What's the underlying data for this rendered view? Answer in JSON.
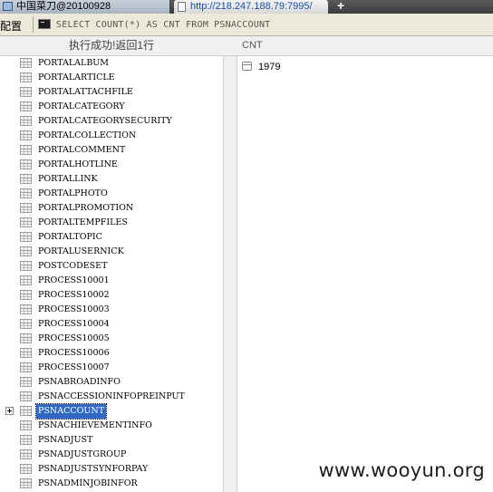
{
  "tabs": [
    {
      "label": "中国菜刀@20100928"
    },
    {
      "label": "http://218.247.188.79:7995/"
    }
  ],
  "new_tab_symbol": "+",
  "toolbar": {
    "config_label": "配置",
    "sql_query": "SELECT COUNT(*) AS CNT FROM PSNACCOUNT"
  },
  "status": {
    "message": "执行成功!返回1行"
  },
  "results": {
    "column_header": "CNT",
    "rows": [
      {
        "value": "1979"
      }
    ]
  },
  "tree": {
    "selected_table": "PSNACCOUNT",
    "tables": [
      "PORTALALBUM",
      "PORTALARTICLE",
      "PORTALATTACHFILE",
      "PORTALCATEGORY",
      "PORTALCATEGORYSECURITY",
      "PORTALCOLLECTION",
      "PORTALCOMMENT",
      "PORTALHOTLINE",
      "PORTALLINK",
      "PORTALPHOTO",
      "PORTALPROMOTION",
      "PORTALTEMPFILES",
      "PORTALTOPIC",
      "PORTALUSERNICK",
      "POSTCODESET",
      "PROCESS10001",
      "PROCESS10002",
      "PROCESS10003",
      "PROCESS10004",
      "PROCESS10005",
      "PROCESS10006",
      "PROCESS10007",
      "PSNABROADINFO",
      "PSNACCESSIONINFOPREINPUT",
      "PSNACCOUNT",
      "PSNACHIEVEMENTINFO",
      "PSNADJUST",
      "PSNADJUSTGROUP",
      "PSNADJUSTSYNFORPAY",
      "PSNADMINJOBINFOR"
    ]
  },
  "watermark": "www.wooyun.org",
  "colors": {
    "selection": "#316ac5",
    "toolbar_bg": "#ece9d8",
    "tab_text_active": "#1a4ea0"
  }
}
